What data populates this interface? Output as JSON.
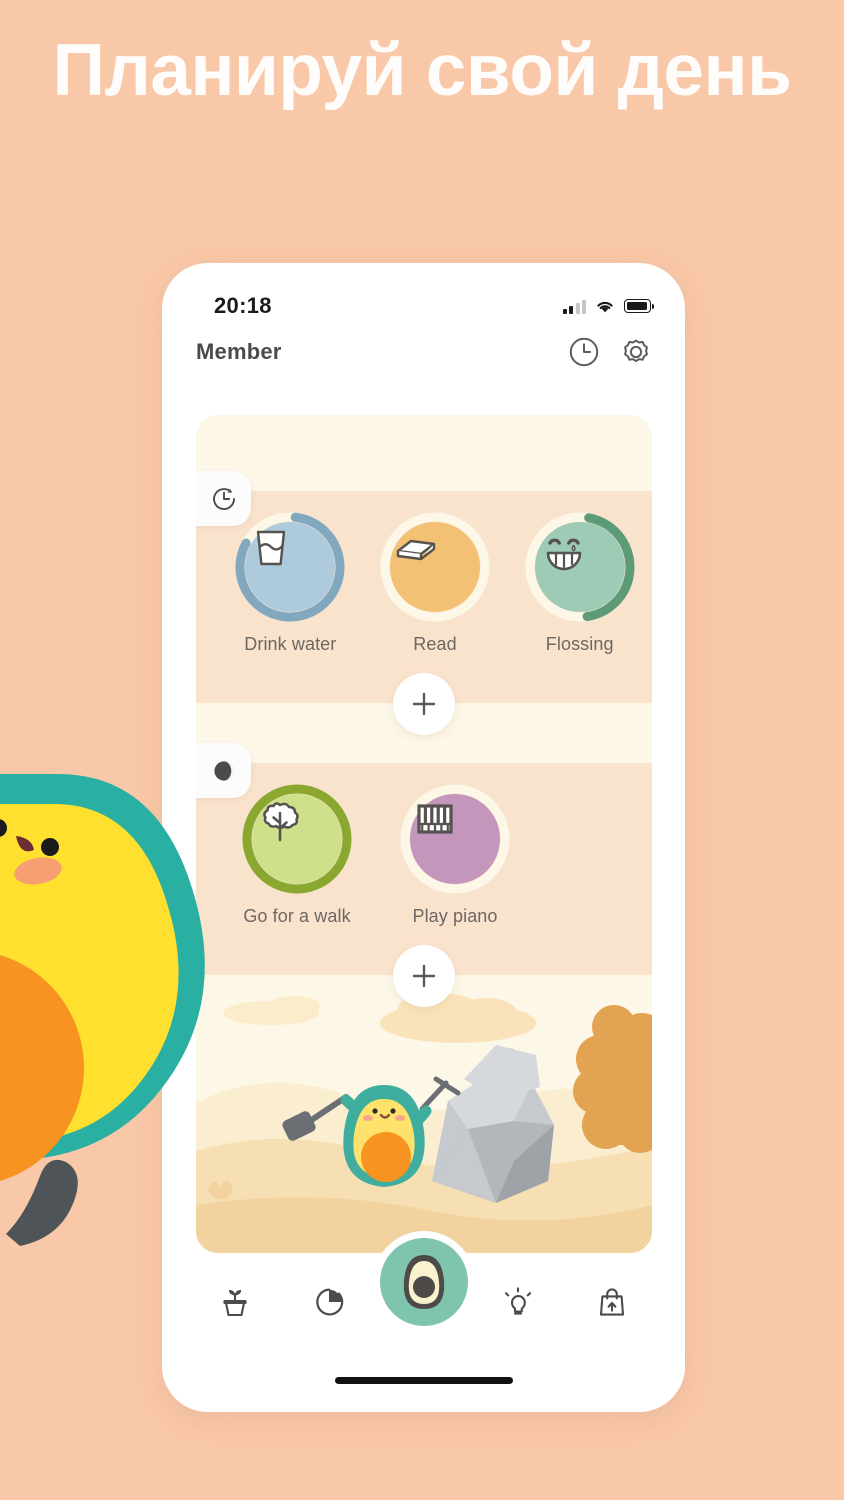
{
  "promo": {
    "headline": "Планируй свой день",
    "background_color": "#f9c8a8",
    "headline_color": "#fffdfb"
  },
  "status_bar": {
    "time": "20:18",
    "signal_icon": "cellular-signal-icon",
    "wifi_icon": "wifi-icon",
    "battery_icon": "battery-icon"
  },
  "app_bar": {
    "title": "Member",
    "history_icon": "clock-icon",
    "settings_icon": "gear-icon"
  },
  "sections": [
    {
      "id": "morning",
      "badge_icon": "clock-icon",
      "band_color": "#fae3cd",
      "add_label": "+",
      "habits": [
        {
          "label": "Drink water",
          "icon": "water-glass-icon",
          "disc_color": "#aecadd",
          "ring_color": "#82a8c0",
          "progress": 90
        },
        {
          "label": "Read",
          "icon": "book-icon",
          "disc_color": "#f3c173",
          "ring_color": "#fdf7e8",
          "progress": 0
        },
        {
          "label": "Flossing",
          "icon": "teeth-smile-icon",
          "disc_color": "#9ecbb5",
          "ring_color": "#5c9a78",
          "progress": 50
        }
      ]
    },
    {
      "id": "evening",
      "badge_icon": "moon-icon",
      "band_color": "#fae3cd",
      "add_label": "+",
      "habits": [
        {
          "label": "Go for a walk",
          "icon": "tree-icon",
          "disc_color": "#cfe08a",
          "ring_color": "#8aa82f",
          "progress": 100
        },
        {
          "label": "Play piano",
          "icon": "piano-icon",
          "disc_color": "#c496bb",
          "ring_color": "#fdf7e8",
          "progress": 0
        }
      ]
    }
  ],
  "scene": {
    "description": "avocado-mining-scene",
    "sky_color": "#fdf7e8",
    "sand_color": "#f5dcb0",
    "rock_color": "#b7bcc0",
    "bush_color": "#e2a353"
  },
  "bottom_nav": {
    "items": [
      {
        "icon": "plant-pot-icon",
        "name": "garden"
      },
      {
        "icon": "pie-chart-icon",
        "name": "statistics"
      },
      {
        "icon": "avocado-icon",
        "name": "home",
        "is_fab": true,
        "color": "#7fc4ad"
      },
      {
        "icon": "lightbulb-icon",
        "name": "tips"
      },
      {
        "icon": "shopping-bag-icon",
        "name": "shop"
      }
    ],
    "home_indicator": "home-indicator"
  },
  "mascot": {
    "name": "avocado-mascot",
    "skin_color": "#2ab0a2",
    "flesh_color": "#ffe02e",
    "pit_color": "#f79421"
  }
}
